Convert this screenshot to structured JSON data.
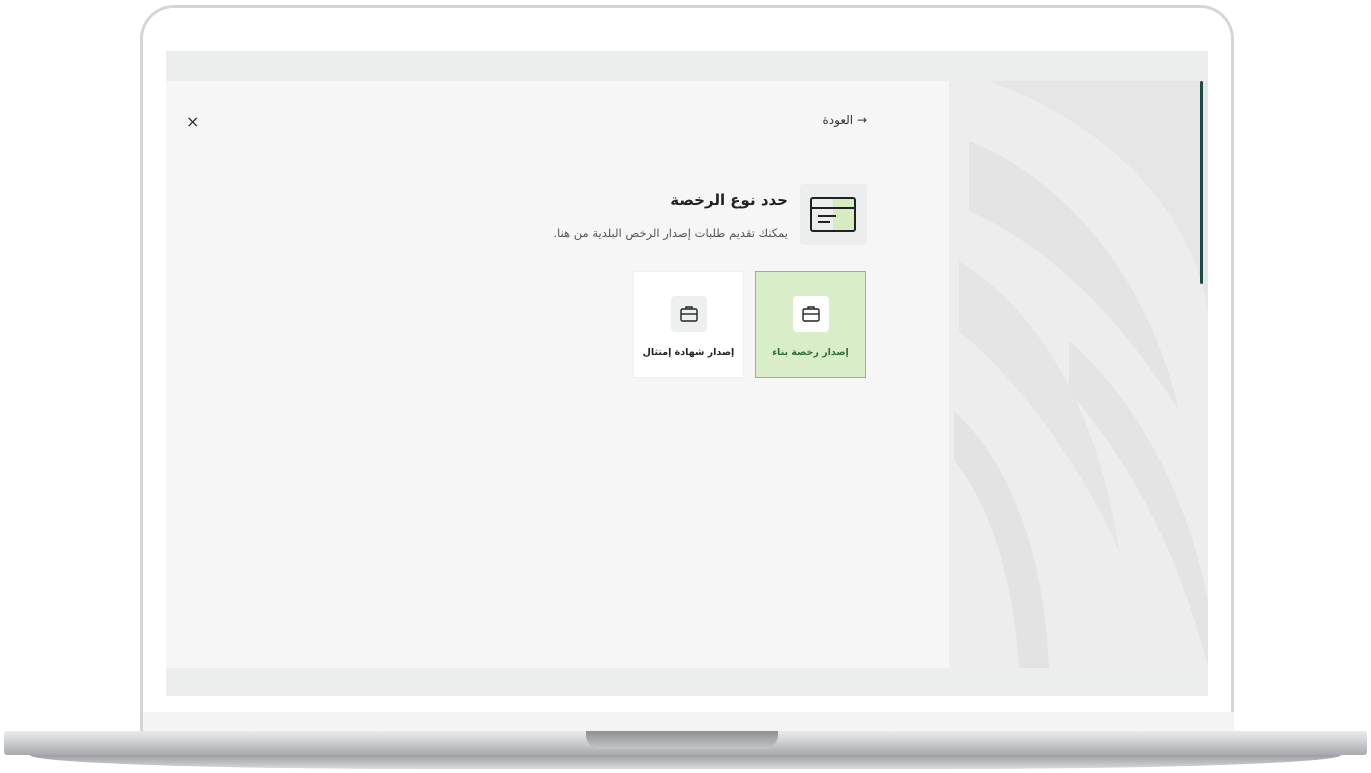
{
  "dialog": {
    "back_label": "→ العودة",
    "close_label": "×",
    "title": "حدد نوع الرخصة",
    "subtitle": "يمكنك تقديم طلبات إصدار الرخص البلدية من هنا."
  },
  "options": [
    {
      "label": "إصدار رخصة بناء",
      "selected": true,
      "icon": "briefcase-icon"
    },
    {
      "label": "إصدار شهادة إمتثال",
      "selected": false,
      "icon": "briefcase-icon"
    }
  ],
  "colors": {
    "selected_bg": "#d9edc8",
    "selected_border": "#8ac06a",
    "selected_text": "#2f6f35",
    "scrollbar": "#1d4b43"
  }
}
